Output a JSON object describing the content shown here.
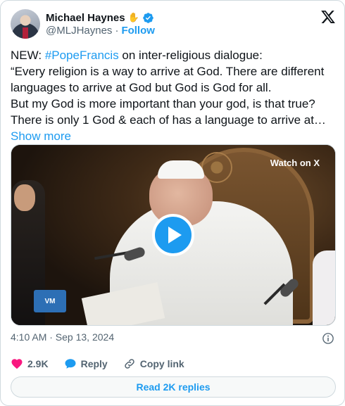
{
  "author": {
    "display_name": "Michael Haynes",
    "handle": "@MLJHaynes",
    "separator": "·",
    "follow_label": "Follow"
  },
  "tweet": {
    "prefix": "NEW: ",
    "hashtag": "#PopeFrancis",
    "body": " on inter-religious dialogue:\n“Every religion is a way to arrive at God. There are different languages to arrive at God but God is God for all.\nBut my God is more important than your god, is that true? There is only 1 God & each of has a language to arrive at… ",
    "show_more": "Show more"
  },
  "media": {
    "watch_label": "Watch on X"
  },
  "meta": {
    "timestamp": "4:10 AM · Sep 13, 2024"
  },
  "actions": {
    "like_count": "2.9K",
    "reply_label": "Reply",
    "copy_label": "Copy link"
  },
  "footer": {
    "read_replies": "Read 2K replies"
  },
  "colors": {
    "accent": "#1d9bf0",
    "heart": "#f91880",
    "muted": "#536471"
  }
}
